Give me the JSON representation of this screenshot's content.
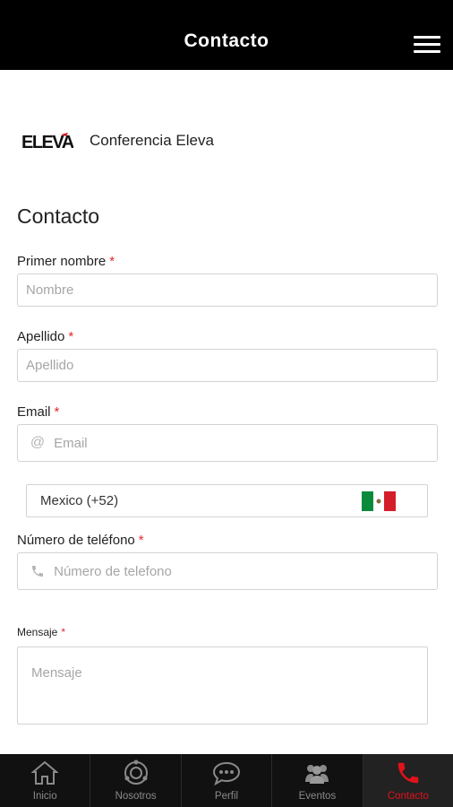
{
  "header": {
    "title": "Contacto"
  },
  "brand": {
    "logo_text": "ELEVA",
    "name": "Conferencia Eleva"
  },
  "form": {
    "title": "Contacto",
    "required_mark": "*",
    "first_name": {
      "label": "Primer nombre",
      "placeholder": "Nombre"
    },
    "last_name": {
      "label": "Apellido",
      "placeholder": "Apellido"
    },
    "email": {
      "label": "Email",
      "placeholder": "Email",
      "icon_glyph": "@"
    },
    "country": {
      "value": "Mexico (+52)",
      "flag_colors": [
        "#0c8a3c",
        "#ffffff",
        "#d41e2a"
      ]
    },
    "phone": {
      "label": "Número de teléfono",
      "placeholder": "Número de telefono"
    },
    "message": {
      "label": "Mensaje",
      "placeholder": "Mensaje"
    }
  },
  "tabs": [
    {
      "label": "Inicio",
      "icon": "home-icon",
      "active": false
    },
    {
      "label": "Nosotros",
      "icon": "orbit-icon",
      "active": false
    },
    {
      "label": "Perfil",
      "icon": "chat-icon",
      "active": false
    },
    {
      "label": "Eventos",
      "icon": "people-icon",
      "active": false
    },
    {
      "label": "Contacto",
      "icon": "phone-icon",
      "active": true
    }
  ],
  "colors": {
    "accent": "#e0121b",
    "header_bg": "#000000",
    "tabbar_bg": "#111111"
  }
}
